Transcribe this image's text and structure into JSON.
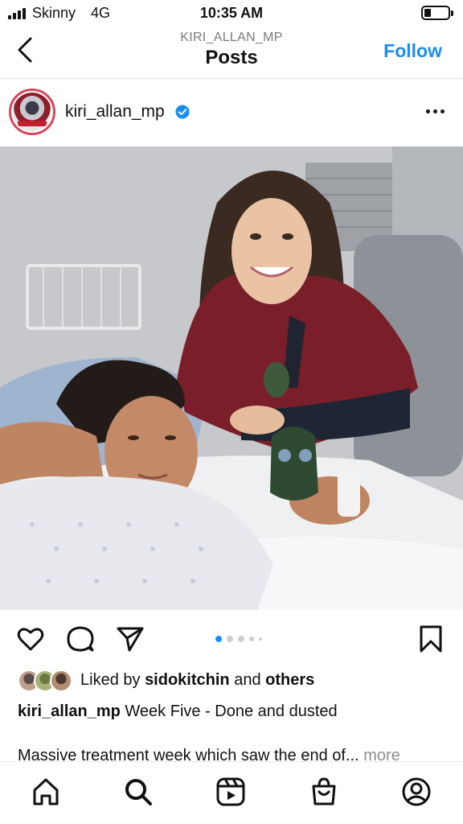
{
  "status_bar": {
    "carrier": "Skinny",
    "network": "4G",
    "time": "10:35 AM"
  },
  "header": {
    "subtitle": "KIRI_ALLAN_MP",
    "title": "Posts",
    "follow_label": "Follow"
  },
  "post": {
    "username": "kiri_allan_mp",
    "verified": true,
    "carousel_count": 5,
    "carousel_active": 1,
    "likes_prefix": "Liked by",
    "liked_by_user": "sidokitchin",
    "likes_joiner": "and",
    "likes_others": "others",
    "caption_username": "kiri_allan_mp",
    "caption_text": "Week Five - Done and dusted",
    "caption_line2": "Massive treatment week which saw the end of...",
    "more_label": "more"
  },
  "colors": {
    "accent": "#1a8ef0",
    "verified": "#1a8ef0",
    "story_ring": "#d9475b"
  },
  "icons": {
    "back": "chevron-left-icon",
    "more": "more-horizontal-icon",
    "like": "heart-icon",
    "comment": "comment-icon",
    "share": "send-icon",
    "save": "bookmark-icon",
    "nav": [
      "home-icon",
      "search-icon",
      "reels-icon",
      "shop-icon",
      "profile-icon"
    ]
  }
}
